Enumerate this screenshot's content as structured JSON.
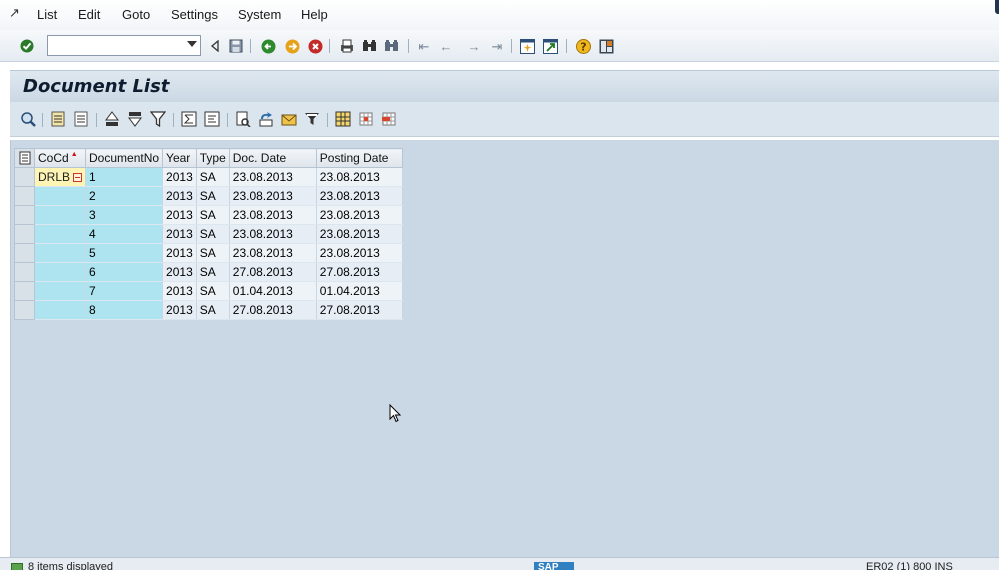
{
  "menubar": {
    "items": [
      {
        "label": "List"
      },
      {
        "label": "Edit"
      },
      {
        "label": "Goto"
      },
      {
        "label": "Settings"
      },
      {
        "label": "System"
      },
      {
        "label": "Help"
      }
    ]
  },
  "toolbar": {
    "command_value": "",
    "icons": [
      "enter-icon",
      "back-icon",
      "save-icon",
      "back-arrow-icon",
      "exit-icon",
      "cancel-icon",
      "print-icon",
      "find-icon",
      "find-next-icon",
      "first-page-icon",
      "previous-page-icon",
      "next-page-icon",
      "last-page-icon",
      "create-session-icon",
      "shortcut-icon",
      "help-icon",
      "layout-icon"
    ]
  },
  "title": "Document List",
  "app_toolbar": {
    "icons": [
      "details-icon",
      "select-all-icon",
      "deselect-all-icon",
      "sort-ascending-icon",
      "sort-descending-icon",
      "filter-icon",
      "total-icon",
      "subtotal-icon",
      "print-preview-icon",
      "export-icon",
      "email-icon",
      "abc-analysis-icon",
      "graphic-icon",
      "layout-change-icon",
      "layout-select-icon",
      "layout-save-icon"
    ]
  },
  "grid": {
    "columns": [
      "CoCd",
      "DocumentNo",
      "Year",
      "Type",
      "Doc. Date",
      "Posting Date"
    ],
    "rows": [
      {
        "cocd": "DRLB",
        "docno": "1",
        "year": "2013",
        "type": "SA",
        "doc_date": "23.08.2013",
        "post_date": "23.08.2013"
      },
      {
        "cocd": "",
        "docno": "2",
        "year": "2013",
        "type": "SA",
        "doc_date": "23.08.2013",
        "post_date": "23.08.2013"
      },
      {
        "cocd": "",
        "docno": "3",
        "year": "2013",
        "type": "SA",
        "doc_date": "23.08.2013",
        "post_date": "23.08.2013"
      },
      {
        "cocd": "",
        "docno": "4",
        "year": "2013",
        "type": "SA",
        "doc_date": "23.08.2013",
        "post_date": "23.08.2013"
      },
      {
        "cocd": "",
        "docno": "5",
        "year": "2013",
        "type": "SA",
        "doc_date": "23.08.2013",
        "post_date": "23.08.2013"
      },
      {
        "cocd": "",
        "docno": "6",
        "year": "2013",
        "type": "SA",
        "doc_date": "27.08.2013",
        "post_date": "27.08.2013"
      },
      {
        "cocd": "",
        "docno": "7",
        "year": "2013",
        "type": "SA",
        "doc_date": "01.04.2013",
        "post_date": "01.04.2013"
      },
      {
        "cocd": "",
        "docno": "8",
        "year": "2013",
        "type": "SA",
        "doc_date": "27.08.2013",
        "post_date": "27.08.2013"
      }
    ]
  },
  "statusbar": {
    "message": "8 items displayed",
    "logo": "SAP",
    "system_info": "ER02 (1) 800  INS"
  },
  "colors": {
    "key_column": "#aee4f0",
    "subtotal_cell": "#fef4b4",
    "work_area": "#cad8e5"
  }
}
